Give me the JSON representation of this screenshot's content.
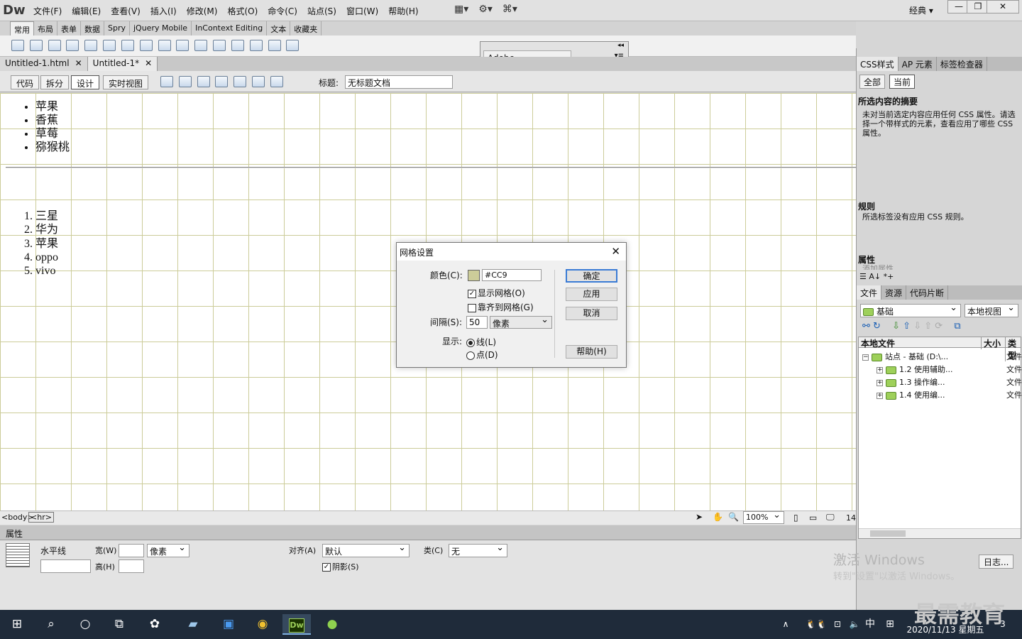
{
  "app": {
    "logo": "Dw",
    "workspace": "经典"
  },
  "menu": [
    "文件(F)",
    "编辑(E)",
    "查看(V)",
    "插入(I)",
    "修改(M)",
    "格式(O)",
    "命令(C)",
    "站点(S)",
    "窗口(W)",
    "帮助(H)"
  ],
  "insert_tabs": [
    "常用",
    "布局",
    "表单",
    "数据",
    "Spry",
    "jQuery Mobile",
    "InContext Editing",
    "文本",
    "收藏夹"
  ],
  "browserlab": {
    "title": "Adobe BrowserLab"
  },
  "doc_tabs": [
    {
      "name": "Untitled-1.html"
    },
    {
      "name": "Untitled-1*"
    }
  ],
  "view_buttons": [
    "代码",
    "拆分",
    "设计",
    "实时视图"
  ],
  "doc_title": {
    "label": "标题:",
    "value": "无标题文档"
  },
  "design": {
    "ul": [
      "苹果",
      "香蕉",
      "草莓",
      "猕猴桃"
    ],
    "ol": [
      "三星",
      "华为",
      "苹果",
      "oppo",
      "vivo"
    ],
    "grid_color": "#CCCC99"
  },
  "status": {
    "tags": [
      "<body>",
      "<hr>"
    ],
    "zoom": "100%",
    "size": "14"
  },
  "properties": {
    "tab": "属性",
    "element": "水平线",
    "width_label": "宽(W)",
    "unit": "像素",
    "height_label": "高(H)",
    "align_label": "对齐(A)",
    "align_value": "默认",
    "class_label": "类(C)",
    "class_value": "无",
    "shadow_label": "阴影(S)"
  },
  "css_panel": {
    "tabs": [
      "CSS样式",
      "AP 元素",
      "标签检查器"
    ],
    "modes": [
      "全部",
      "当前"
    ],
    "summary_title": "所选内容的摘要",
    "summary_text": "未对当前选定内容应用任何 CSS 属性。请选择一个带样式的元素，查看应用了哪些 CSS 属性。",
    "rules_title": "规则",
    "rules_text": "所选标签没有应用 CSS 规则。",
    "attr_title": "属性",
    "attr_add": "添加属性"
  },
  "files_panel": {
    "tabs": [
      "文件",
      "资源",
      "代码片断"
    ],
    "site": "基础",
    "view": "本地视图",
    "col_local": "本地文件",
    "col_size": "大小",
    "col_type": "类型",
    "root": "站点 - 基础 (D:\\...",
    "root_type": "文件",
    "items": [
      {
        "name": "1.2 使用辅助...",
        "type": "文件"
      },
      {
        "name": "1.3 操作编...",
        "type": "文件"
      },
      {
        "name": "1.4 使用编...",
        "type": "文件"
      }
    ],
    "log_button": "日志..."
  },
  "dialog": {
    "title": "网格设置",
    "color_label": "颜色(C):",
    "color_value": "#CC9",
    "show_grid": "显示网格(O)",
    "snap_grid": "靠齐到网格(G)",
    "spacing_label": "间隔(S):",
    "spacing_value": "50",
    "spacing_unit": "像素",
    "display_label": "显示:",
    "opt_line": "线(L)",
    "opt_dot": "点(D)",
    "ok": "确定",
    "apply": "应用",
    "cancel": "取消",
    "help": "帮助(H)",
    "swatch_color": "#CCCC99"
  },
  "watermark": {
    "line1": "激活 Windows",
    "line2": "转到\"设置\"以激活 Windows。",
    "brand": "最需教育"
  },
  "taskbar": {
    "ime": "中",
    "datetime": "2020/11/13 星期五",
    "notif": "3"
  }
}
